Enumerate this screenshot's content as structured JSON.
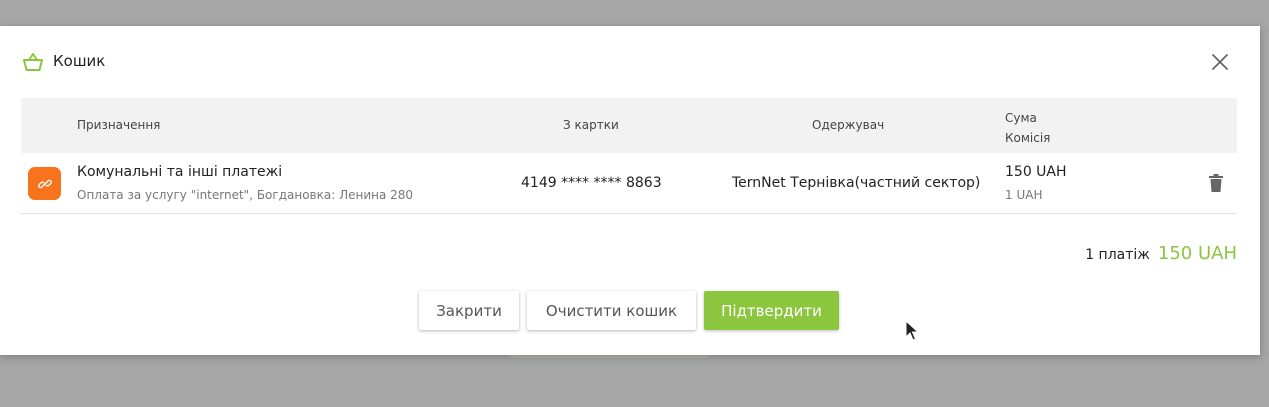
{
  "modal": {
    "title": "Кошик",
    "accent_color": "#8cc63f",
    "icons": {
      "title": "basket-icon",
      "close": "close-icon"
    }
  },
  "table": {
    "headers": {
      "purpose": "Призначення",
      "card": "З картки",
      "recipient": "Одержувач",
      "amount": "Сума",
      "fee": "Комісія"
    },
    "rows": [
      {
        "icon": "utilities-icon",
        "icon_color": "#f7731c",
        "title": "Комунальні та інші платежі",
        "subtitle": "Оплата за услугу \"internet\", Богдановка: Ленина 280",
        "card": "4149 **** **** 8863",
        "recipient": "TernNet Тернівка(частний сектор)",
        "sum": "150 UAH",
        "fee": "1 UAH",
        "delete_icon": "trash-icon"
      }
    ]
  },
  "total": {
    "count_label": "1 платіж",
    "sum": "150 UAH"
  },
  "buttons": {
    "close": "Закрити",
    "clear": "Очистити кошик",
    "confirm": "Підтвердити"
  }
}
